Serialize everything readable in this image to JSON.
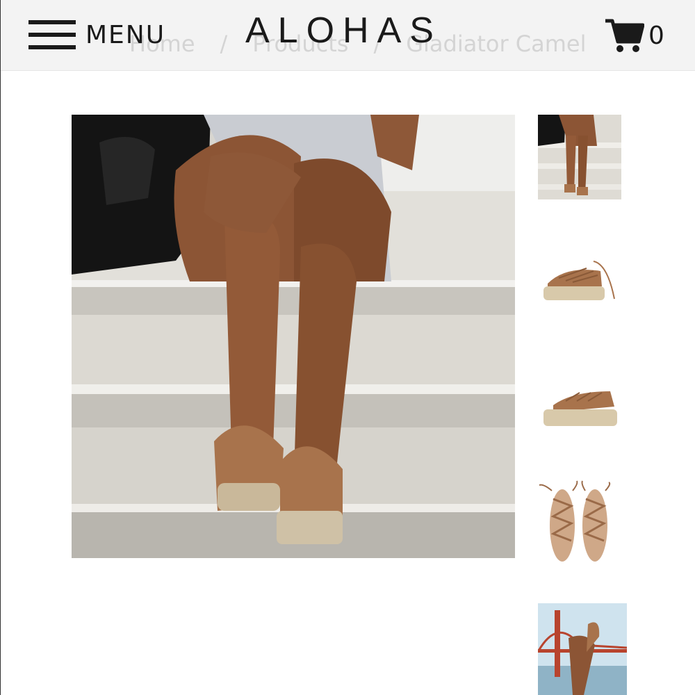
{
  "header": {
    "menu_label": "MENU",
    "logo": "ALOHAS",
    "cart_count": "0"
  },
  "breadcrumb": {
    "items": [
      "Home",
      "Products",
      "Gladiator Camel"
    ],
    "separator": "/"
  },
  "gallery": {
    "main_image": "lifestyle-photo-sandals-on-stairs",
    "thumbnails": [
      "lifestyle-stairs",
      "side-view-laces",
      "side-view",
      "top-view-pair",
      "bridge-lifestyle"
    ]
  },
  "colors": {
    "header_bg": "#f3f3f3",
    "text": "#1a1a1a",
    "breadcrumb": "#d4d4d4",
    "camel": "#a8734c"
  }
}
